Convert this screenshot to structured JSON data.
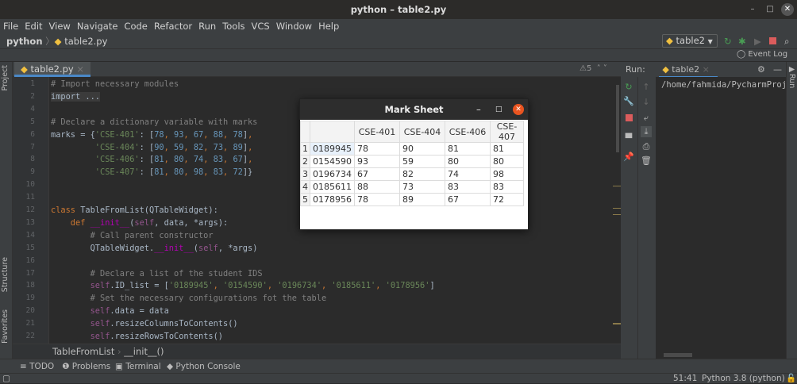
{
  "window": {
    "title": "python – table2.py"
  },
  "menu": [
    "File",
    "Edit",
    "View",
    "Navigate",
    "Code",
    "Refactor",
    "Run",
    "Tools",
    "VCS",
    "Window",
    "Help"
  ],
  "nav": {
    "project": "python",
    "file": "table2.py",
    "run_config": "table2",
    "event_log": "Event Log"
  },
  "editor": {
    "tab": "table2.py",
    "warnings": "5",
    "lines": [
      {
        "n": "1",
        "tokens": [
          {
            "t": "# Import necessary modules",
            "c": "cm"
          }
        ]
      },
      {
        "n": "2",
        "tokens": [
          {
            "t": "import ...",
            "c": "fo"
          }
        ]
      },
      {
        "n": "4",
        "tokens": []
      },
      {
        "n": "5",
        "tokens": [
          {
            "t": "# Declare a dictionary variable with marks",
            "c": "cm"
          }
        ]
      },
      {
        "n": "6",
        "tokens": [
          {
            "t": "marks = {",
            "c": ""
          },
          {
            "t": "'CSE-401'",
            "c": "st"
          },
          {
            "t": ": [",
            "c": ""
          },
          {
            "t": "78",
            "c": "nu"
          },
          {
            "t": ", ",
            "c": "kw"
          },
          {
            "t": "93",
            "c": "nu"
          },
          {
            "t": ", ",
            "c": "kw"
          },
          {
            "t": "67",
            "c": "nu"
          },
          {
            "t": ", ",
            "c": "kw"
          },
          {
            "t": "88",
            "c": "nu"
          },
          {
            "t": ", ",
            "c": "kw"
          },
          {
            "t": "78",
            "c": "nu"
          },
          {
            "t": "]",
            "c": ""
          },
          {
            "t": ",",
            "c": "kw"
          }
        ]
      },
      {
        "n": "7",
        "tokens": [
          {
            "t": "         ",
            "c": ""
          },
          {
            "t": "'CSE-404'",
            "c": "st"
          },
          {
            "t": ": [",
            "c": ""
          },
          {
            "t": "90",
            "c": "nu"
          },
          {
            "t": ", ",
            "c": "kw"
          },
          {
            "t": "59",
            "c": "nu"
          },
          {
            "t": ", ",
            "c": "kw"
          },
          {
            "t": "82",
            "c": "nu"
          },
          {
            "t": ", ",
            "c": "kw"
          },
          {
            "t": "73",
            "c": "nu"
          },
          {
            "t": ", ",
            "c": "kw"
          },
          {
            "t": "89",
            "c": "nu"
          },
          {
            "t": "]",
            "c": ""
          },
          {
            "t": ",",
            "c": "kw"
          }
        ]
      },
      {
        "n": "8",
        "tokens": [
          {
            "t": "         ",
            "c": ""
          },
          {
            "t": "'CSE-406'",
            "c": "st"
          },
          {
            "t": ": [",
            "c": ""
          },
          {
            "t": "81",
            "c": "nu"
          },
          {
            "t": ", ",
            "c": "kw"
          },
          {
            "t": "80",
            "c": "nu"
          },
          {
            "t": ", ",
            "c": "kw"
          },
          {
            "t": "74",
            "c": "nu"
          },
          {
            "t": ", ",
            "c": "kw"
          },
          {
            "t": "83",
            "c": "nu"
          },
          {
            "t": ", ",
            "c": "kw"
          },
          {
            "t": "67",
            "c": "nu"
          },
          {
            "t": "]",
            "c": ""
          },
          {
            "t": ",",
            "c": "kw"
          }
        ]
      },
      {
        "n": "9",
        "tokens": [
          {
            "t": "         ",
            "c": ""
          },
          {
            "t": "'CSE-407'",
            "c": "st"
          },
          {
            "t": ": [",
            "c": ""
          },
          {
            "t": "81",
            "c": "nu"
          },
          {
            "t": ", ",
            "c": "kw"
          },
          {
            "t": "80",
            "c": "nu"
          },
          {
            "t": ", ",
            "c": "kw"
          },
          {
            "t": "98",
            "c": "nu"
          },
          {
            "t": ", ",
            "c": "kw"
          },
          {
            "t": "83",
            "c": "nu"
          },
          {
            "t": ", ",
            "c": "kw"
          },
          {
            "t": "72",
            "c": "nu"
          },
          {
            "t": "]}",
            "c": ""
          }
        ]
      },
      {
        "n": "10",
        "tokens": []
      },
      {
        "n": "11",
        "tokens": []
      },
      {
        "n": "12",
        "tokens": [
          {
            "t": "class ",
            "c": "kw"
          },
          {
            "t": "TableFromList(QTableWidget):",
            "c": ""
          }
        ]
      },
      {
        "n": "13",
        "tokens": [
          {
            "t": "    def ",
            "c": "kw"
          },
          {
            "t": "__init__",
            "c": "du"
          },
          {
            "t": "(",
            "c": ""
          },
          {
            "t": "self",
            "c": "sf"
          },
          {
            "t": ", data, *args):",
            "c": ""
          }
        ]
      },
      {
        "n": "14",
        "tokens": [
          {
            "t": "        # Call parent constructor",
            "c": "cm"
          }
        ]
      },
      {
        "n": "15",
        "tokens": [
          {
            "t": "        QTableWidget.",
            "c": ""
          },
          {
            "t": "__init__",
            "c": "du"
          },
          {
            "t": "(",
            "c": ""
          },
          {
            "t": "self",
            "c": "sf"
          },
          {
            "t": ", *args)",
            "c": ""
          }
        ]
      },
      {
        "n": "16",
        "tokens": []
      },
      {
        "n": "17",
        "tokens": [
          {
            "t": "        # Declare a list of the student IDS",
            "c": "cm"
          }
        ]
      },
      {
        "n": "18",
        "tokens": [
          {
            "t": "        ",
            "c": ""
          },
          {
            "t": "self",
            "c": "sf"
          },
          {
            "t": ".ID_list = [",
            "c": ""
          },
          {
            "t": "'0189945'",
            "c": "st"
          },
          {
            "t": ", ",
            "c": "kw"
          },
          {
            "t": "'0154590'",
            "c": "st"
          },
          {
            "t": ", ",
            "c": "kw"
          },
          {
            "t": "'0196734'",
            "c": "st"
          },
          {
            "t": ", ",
            "c": "kw"
          },
          {
            "t": "'0185611'",
            "c": "st"
          },
          {
            "t": ", ",
            "c": "kw"
          },
          {
            "t": "'0178956'",
            "c": "st"
          },
          {
            "t": "]",
            "c": ""
          }
        ]
      },
      {
        "n": "19",
        "tokens": [
          {
            "t": "        # Set the necessary configurations fot the table",
            "c": "cm"
          }
        ]
      },
      {
        "n": "20",
        "tokens": [
          {
            "t": "        ",
            "c": ""
          },
          {
            "t": "self",
            "c": "sf"
          },
          {
            "t": ".data = data",
            "c": ""
          }
        ]
      },
      {
        "n": "21",
        "tokens": [
          {
            "t": "        ",
            "c": ""
          },
          {
            "t": "self",
            "c": "sf"
          },
          {
            "t": ".resizeColumnsToContents()",
            "c": ""
          }
        ]
      },
      {
        "n": "22",
        "tokens": [
          {
            "t": "        ",
            "c": ""
          },
          {
            "t": "self",
            "c": "sf"
          },
          {
            "t": ".resizeRowsToContents()",
            "c": ""
          }
        ]
      }
    ],
    "breadcrumb": [
      "TableFromList",
      "__init__()"
    ]
  },
  "left_tools": {
    "project": "Project",
    "structure": "Structure",
    "favorites": "Favorites"
  },
  "run": {
    "label": "Run:",
    "tab": "table2",
    "output": "/home/fahmida/PycharmProjec",
    "side": "Run"
  },
  "bottom_tabs": [
    "TODO",
    "Problems",
    "Terminal",
    "Python Console"
  ],
  "status": {
    "position": "51:41",
    "interpreter": "Python 3.8 (python)"
  },
  "dialog": {
    "title": "Mark Sheet",
    "headers": [
      "CSE-401",
      "CSE-404",
      "CSE-406",
      "CSE-407"
    ],
    "rows": [
      {
        "n": "1",
        "id": "0189945",
        "v": [
          "78",
          "90",
          "81",
          "81"
        ]
      },
      {
        "n": "2",
        "id": "0154590",
        "v": [
          "93",
          "59",
          "80",
          "80"
        ]
      },
      {
        "n": "3",
        "id": "0196734",
        "v": [
          "67",
          "82",
          "74",
          "98"
        ]
      },
      {
        "n": "4",
        "id": "0185611",
        "v": [
          "88",
          "73",
          "83",
          "83"
        ]
      },
      {
        "n": "5",
        "id": "0178956",
        "v": [
          "78",
          "89",
          "67",
          "72"
        ]
      }
    ]
  },
  "colors": {
    "accent": "#4a88c7",
    "run_green": "#499c54",
    "stop_red": "#db5c5c",
    "close_orange": "#e95420"
  }
}
